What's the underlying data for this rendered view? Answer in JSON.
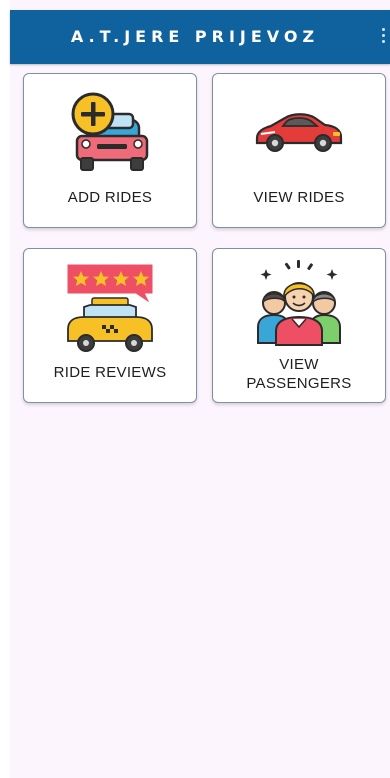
{
  "app_bar": {
    "title": "A.T.JERE PRIJEVOZ",
    "overflow_icon": "more-vertical-icon",
    "background_color": "#10629f"
  },
  "tiles": [
    {
      "label": "ADD RIDES",
      "icon": "add-car-icon"
    },
    {
      "label": "VIEW RIDES",
      "icon": "red-sports-car-icon"
    },
    {
      "label": "RIDE REVIEWS",
      "icon": "taxi-star-rating-icon"
    },
    {
      "label": "VIEW\nPASSENGERS",
      "icon": "passengers-group-icon"
    }
  ],
  "colors": {
    "content_background": "#fdf5fd",
    "tile_border": "#7f8fa8"
  }
}
